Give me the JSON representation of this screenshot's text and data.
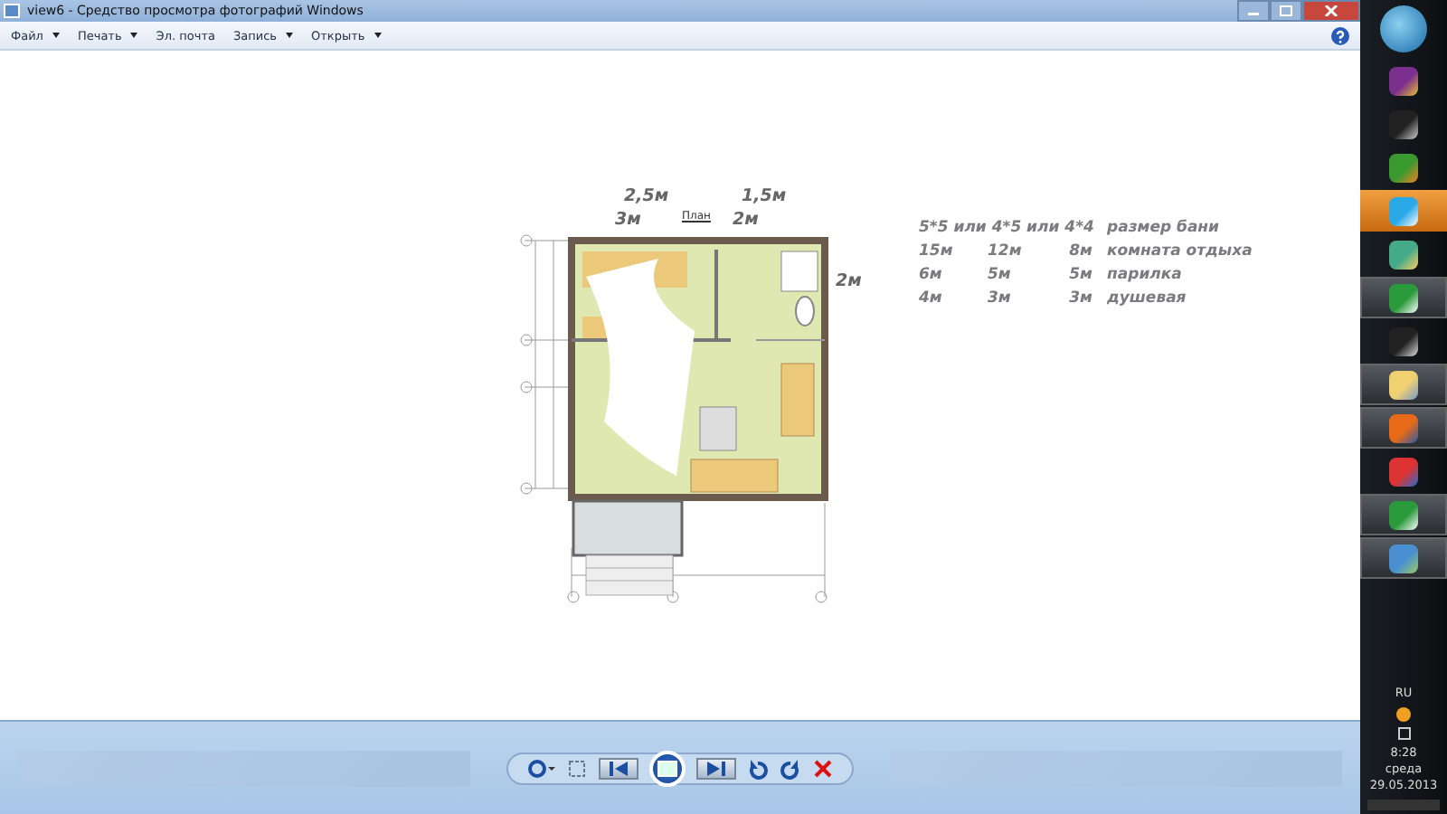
{
  "window": {
    "title": "view6 - Средство просмотра фотографий Windows"
  },
  "menu": [
    {
      "label": "Файл",
      "dropdown": true
    },
    {
      "label": "Печать",
      "dropdown": true
    },
    {
      "label": "Эл. почта",
      "dropdown": false
    },
    {
      "label": "Запись",
      "dropdown": true
    },
    {
      "label": "Открыть",
      "dropdown": true
    }
  ],
  "plan": {
    "title": "План",
    "notes": [
      "2,5м",
      "3м",
      "1,5м",
      "2м",
      "2м"
    ]
  },
  "sizes_table": {
    "header": {
      "sizes": "5*5 или 4*5 или 4*4",
      "label": "размер бани"
    },
    "rows": [
      {
        "cells": [
          "15м",
          "12м",
          "8м"
        ],
        "label": "комната отдыха"
      },
      {
        "cells": [
          "6м",
          "5м",
          "5м"
        ],
        "label": "парилка"
      },
      {
        "cells": [
          "4м",
          "3м",
          "3м"
        ],
        "label": "душевая"
      }
    ]
  },
  "taskbar": {
    "buttons": [
      {
        "kind": "book",
        "open": false,
        "alert": false
      },
      {
        "kind": "hook",
        "open": false,
        "alert": false
      },
      {
        "kind": "ball",
        "open": false,
        "alert": false
      },
      {
        "kind": "skype",
        "open": false,
        "alert": true
      },
      {
        "kind": "photos",
        "open": false,
        "alert": false
      },
      {
        "kind": "globe",
        "open": true,
        "alert": false
      },
      {
        "kind": "music",
        "open": false,
        "alert": false
      },
      {
        "kind": "folder",
        "open": true,
        "alert": false
      },
      {
        "kind": "firefox",
        "open": true,
        "alert": false
      },
      {
        "kind": "video",
        "open": false,
        "alert": false
      },
      {
        "kind": "mail",
        "open": true,
        "alert": false
      },
      {
        "kind": "viewer",
        "open": true,
        "alert": false
      }
    ],
    "language": "RU",
    "time": "8:28",
    "weekday": "среда",
    "date": "29.05.2013"
  }
}
